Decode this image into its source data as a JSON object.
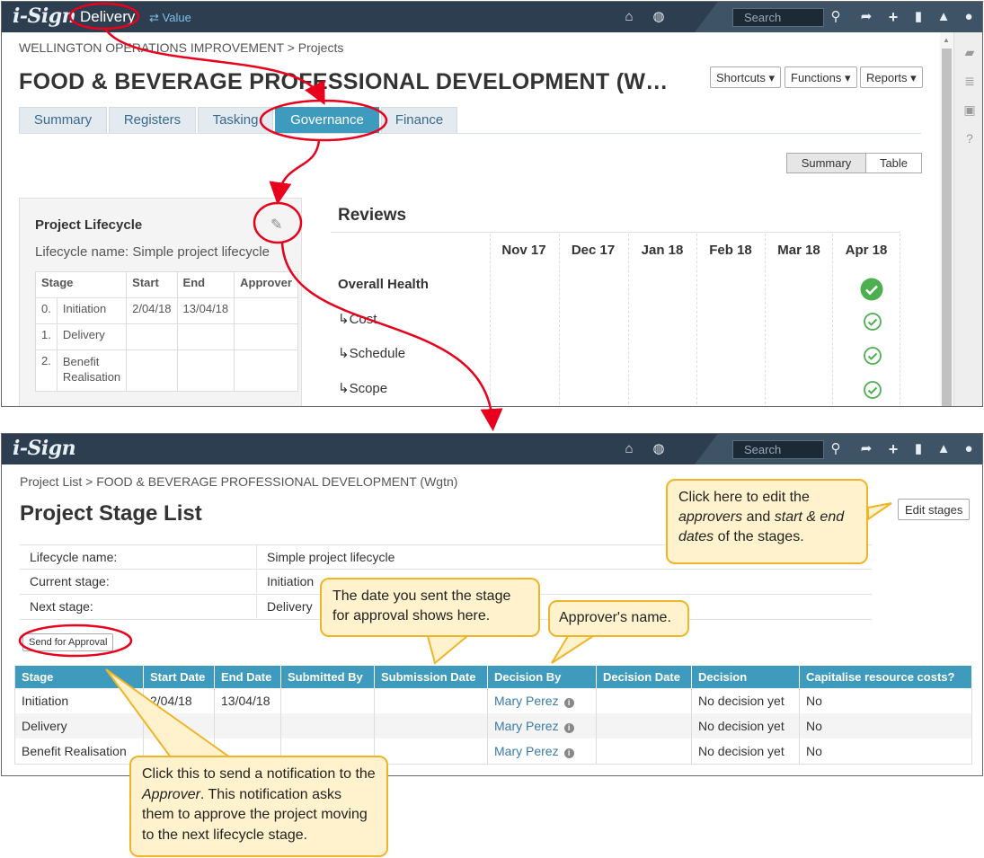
{
  "top": {
    "logo": "i-Sign",
    "module": "Delivery",
    "switch_label": "Value",
    "search_placeholder": "Search",
    "breadcrumb": "WELLINGTON OPERATIONS IMPROVEMENT > Projects",
    "title": "FOOD & BEVERAGE PROFESSIONAL DEVELOPMENT (W…",
    "menus": [
      "Shortcuts",
      "Functions",
      "Reports"
    ],
    "tabs": [
      "Summary",
      "Registers",
      "Tasking",
      "Governance",
      "Finance"
    ],
    "active_tab": "Governance",
    "view_toggle": [
      "Summary",
      "Table"
    ],
    "lifecycle": {
      "title": "Project Lifecycle",
      "name_label": "Lifecycle name: Simple project lifecycle",
      "headers": [
        "Stage",
        "Start",
        "End",
        "Approver"
      ],
      "rows": [
        [
          "0.",
          "Initiation",
          "2/04/18",
          "13/04/18",
          ""
        ],
        [
          "1.",
          "Delivery",
          "",
          "",
          ""
        ],
        [
          "2.",
          "Benefit Realisation",
          "",
          "",
          ""
        ]
      ]
    },
    "reviews": {
      "title": "Reviews",
      "months": [
        "Nov 17",
        "Dec 17",
        "Jan 18",
        "Feb 18",
        "Mar 18",
        "Apr 18"
      ],
      "rows": [
        "Overall Health",
        "↳Cost",
        "↳Schedule",
        "↳Scope"
      ]
    }
  },
  "bottom": {
    "logo": "i-Sign",
    "search_placeholder": "Search",
    "breadcrumb": "Project List > FOOD & BEVERAGE PROFESSIONAL DEVELOPMENT (Wgtn)",
    "title": "Project Stage List",
    "edit_button": "Edit stages",
    "info": [
      {
        "label": "Lifecycle name:",
        "value": "Simple project lifecycle"
      },
      {
        "label": "Current stage:",
        "value": "Initiation"
      },
      {
        "label": "Next stage:",
        "value": "Delivery"
      }
    ],
    "send_button": "Send for Approval",
    "table": {
      "headers": [
        "Stage",
        "Start Date",
        "End Date",
        "Submitted By",
        "Submission Date",
        "Decision By",
        "Decision Date",
        "Decision",
        "Capitalise resource costs?"
      ],
      "rows": [
        [
          "Initiation",
          "2/04/18",
          "13/04/18",
          "",
          "",
          "Mary Perez",
          "",
          "No decision yet",
          "No"
        ],
        [
          "Delivery",
          "",
          "",
          "",
          "",
          "Mary Perez",
          "",
          "No decision yet",
          "No"
        ],
        [
          "Benefit Realisation",
          "",
          "",
          "",
          "",
          "Mary Perez",
          "",
          "No decision yet",
          "No"
        ]
      ]
    }
  },
  "callouts": {
    "edit": [
      "Click here to edit the",
      "approvers",
      " and ",
      "start & end",
      "dates",
      " of the stages."
    ],
    "date": "The date you sent the stage for approval shows here.",
    "approver": "Approver's name.",
    "send": [
      "Click this to send a notification to the ",
      "Approver",
      ". This notification asks them to approve the project moving to the next lifecycle stage."
    ]
  },
  "colors": {
    "accent": "#3e9bbd",
    "navbar": "#2c3e4f",
    "annotation_red": "#e8001c",
    "callout_fill": "#fff2cc",
    "callout_border": "#f0b429",
    "check_green": "#4caf50"
  }
}
